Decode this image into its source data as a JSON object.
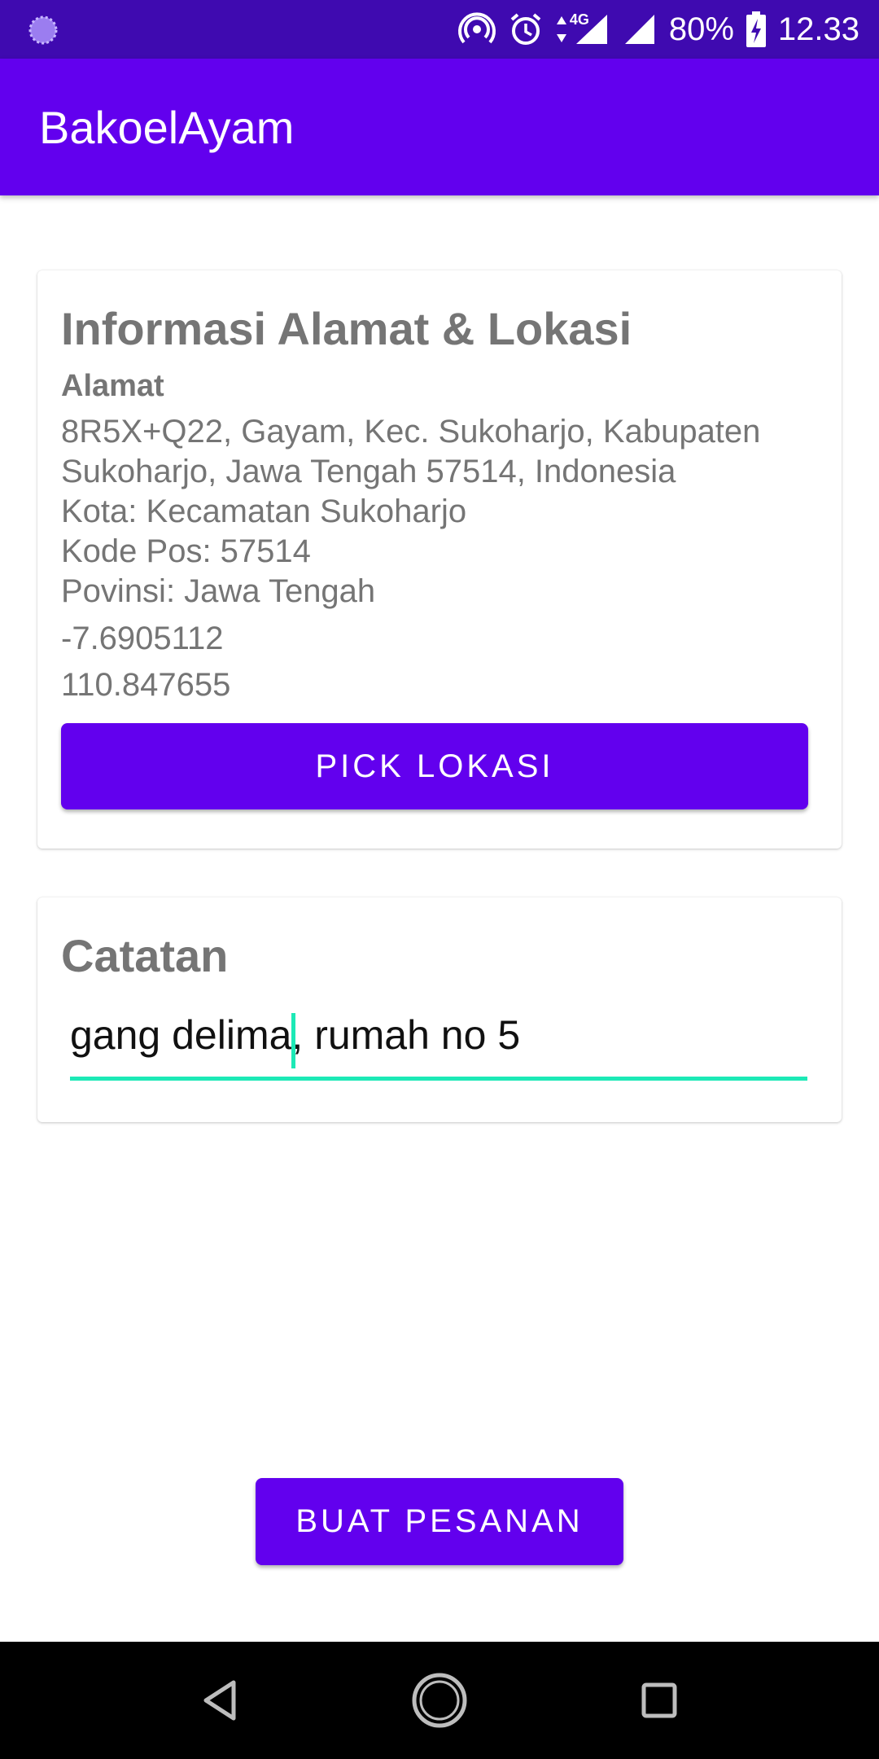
{
  "status_bar": {
    "battery": "80%",
    "time": "12.33",
    "network": "4G",
    "icons": [
      "loading-icon",
      "hotspot-icon",
      "alarm-icon",
      "data-arrows-icon",
      "signal-icon",
      "signal-icon",
      "battery-charging-icon"
    ]
  },
  "app_bar": {
    "title": "BakoelAyam",
    "color": "#6200ee"
  },
  "location_card": {
    "heading": "Informasi Alamat & Lokasi",
    "address_label": "Alamat",
    "address": "8R5X+Q22, Gayam, Kec. Sukoharjo, Kabupaten Sukoharjo, Jawa Tengah 57514, Indonesia",
    "city": "Kota: Kecamatan Sukoharjo",
    "postal_code": "Kode Pos: 57514",
    "province": "Povinsi: Jawa Tengah",
    "latitude": "-7.6905112",
    "longitude": "110.847655",
    "pick_button_label": "PICK LOKASI"
  },
  "notes_card": {
    "heading": "Catatan",
    "input_value": "gang delima, rumah no 5",
    "accent_color": "#1de9b6"
  },
  "order_button_label": "BUAT PESANAN",
  "nav_bar": {
    "icons": [
      "back-icon",
      "home-icon",
      "recent-apps-icon"
    ]
  }
}
